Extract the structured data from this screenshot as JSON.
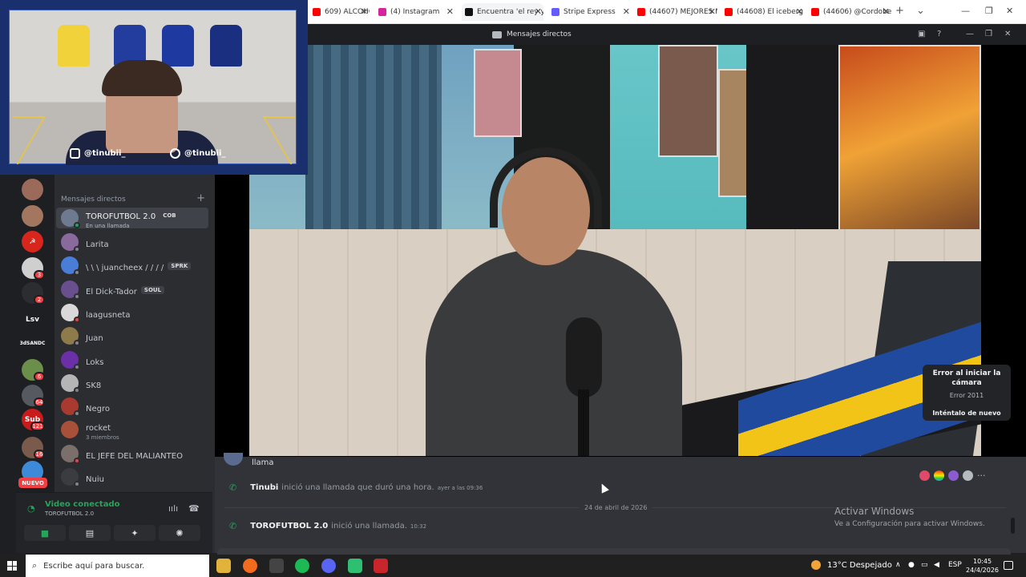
{
  "browser": {
    "tabs": [
      {
        "label": "609) ALCOHOLI",
        "icon": "youtube-icon",
        "color": "#ff0000"
      },
      {
        "label": "(4) Instagram",
        "icon": "instagram-icon",
        "color": "#d6249f"
      },
      {
        "label": "Encuentra 'el rey ya",
        "icon": "tiktok-icon",
        "color": "#111111"
      },
      {
        "label": "Stripe Express",
        "icon": "stripe-icon",
        "color": "#635bff"
      },
      {
        "label": "(44607) MEJORES M",
        "icon": "youtube-icon",
        "color": "#ff0000"
      },
      {
        "label": "(44608) El iceberg d",
        "icon": "youtube-icon",
        "color": "#ff0000"
      },
      {
        "label": "(44606) @Cordobe",
        "icon": "youtube-icon",
        "color": "#ff0000"
      }
    ],
    "new_tab": "+",
    "tab_list": "⌄",
    "min": "—",
    "restore": "❐",
    "close": "✕",
    "tab_close": "✕"
  },
  "facecam": {
    "instagram_handle": "@tinubii_",
    "tiktok_handle": "@tinubii_"
  },
  "discord": {
    "window_title": "Mensajes directos",
    "dm_header": "Mensajes directos",
    "dm_add": "+",
    "nuevo_badge": "NUEVO",
    "servers": [
      {
        "label": "",
        "color": "#9c6a5a",
        "badge": ""
      },
      {
        "label": "",
        "color": "#a3775f",
        "badge": ""
      },
      {
        "label": "☭",
        "color": "#d8261d",
        "badge": ""
      },
      {
        "label": "",
        "color": "#cfcfcf",
        "badge": "3"
      },
      {
        "label": "",
        "color": "#2b2d31",
        "badge": "2"
      },
      {
        "label": "Lsv",
        "color": "#1e1f22",
        "badge": ""
      },
      {
        "label": "3dSANDC",
        "color": "#1e1f22",
        "badge": ""
      },
      {
        "label": "",
        "color": "#6b8f4a",
        "badge": "6"
      },
      {
        "label": "",
        "color": "#555a60",
        "badge": "64"
      },
      {
        "label": "Sub",
        "color": "#c91b1b",
        "badge": "121"
      },
      {
        "label": "",
        "color": "#7a5a4a",
        "badge": "16"
      },
      {
        "label": "",
        "color": "#3c8ad8",
        "badge": ""
      }
    ],
    "dms": [
      {
        "name": "TOROFUTBOL 2.0",
        "tag": "COB",
        "sub": "En una llamada",
        "color": "#6d7a8f",
        "status": "#23a55a",
        "active": true
      },
      {
        "name": "Larita",
        "tag": "",
        "sub": "",
        "color": "#8a6a9c",
        "status": "#80848e",
        "active": false
      },
      {
        "name": "\\ \\ \\ juancheex / / / /",
        "tag": "SPRK",
        "sub": "",
        "color": "#4a7dd8",
        "status": "#80848e",
        "active": false
      },
      {
        "name": "El Dick-Tador",
        "tag": "SOUL",
        "sub": "",
        "color": "#6a4f8f",
        "status": "#80848e",
        "active": false
      },
      {
        "name": "laagusneta",
        "tag": "",
        "sub": "",
        "color": "#d9d9d9",
        "status": "#f23f43",
        "active": false
      },
      {
        "name": "Juan",
        "tag": "",
        "sub": "",
        "color": "#8f7a4a",
        "status": "#80848e",
        "active": false
      },
      {
        "name": "Loks",
        "tag": "",
        "sub": "",
        "color": "#6b2fa8",
        "status": "#80848e",
        "active": false
      },
      {
        "name": "SK8",
        "tag": "",
        "sub": "",
        "color": "#b5b5b5",
        "status": "#80848e",
        "active": false
      },
      {
        "name": "Negro",
        "tag": "",
        "sub": "",
        "color": "#a83a2f",
        "status": "#80848e",
        "active": false
      },
      {
        "name": "rocket",
        "tag": "",
        "sub": "3 miembros",
        "color": "#a8503a",
        "status": "",
        "active": false
      },
      {
        "name": "EL JEFE DEL MALIANTEO",
        "tag": "",
        "sub": "",
        "color": "#7a6f6a",
        "status": "#f23f43",
        "active": false
      },
      {
        "name": "Nuiu",
        "tag": "",
        "sub": "",
        "color": "#3a3c40",
        "status": "#80848e",
        "active": false
      }
    ],
    "voice": {
      "title": "Video conectado",
      "channel": "TOROFUTBOL 2.0"
    },
    "camera_error": {
      "title": "Error al iniciar la cámara",
      "code": "Error 2011",
      "retry": "Inténtalo de nuevo"
    },
    "messages": {
      "first_line": "llama",
      "call1_user": "Tinubi",
      "call1_text": "inició una llamada que duró una hora.",
      "call1_time": "ayer a las 09:36",
      "date_divider": "24 de abril de 2026",
      "call2_user": "TOROFUTBOL 2.0",
      "call2_text": "inició una llamada.",
      "call2_time": "10:32"
    }
  },
  "windows": {
    "activate_title": "Activar Windows",
    "activate_sub": "Ve a Configuración para activar Windows.",
    "search_placeholder": "Escribe aquí para buscar.",
    "weather": "13°C  Despejado",
    "lang": "ESP",
    "time": "10:45",
    "date": "24/4/2026"
  }
}
